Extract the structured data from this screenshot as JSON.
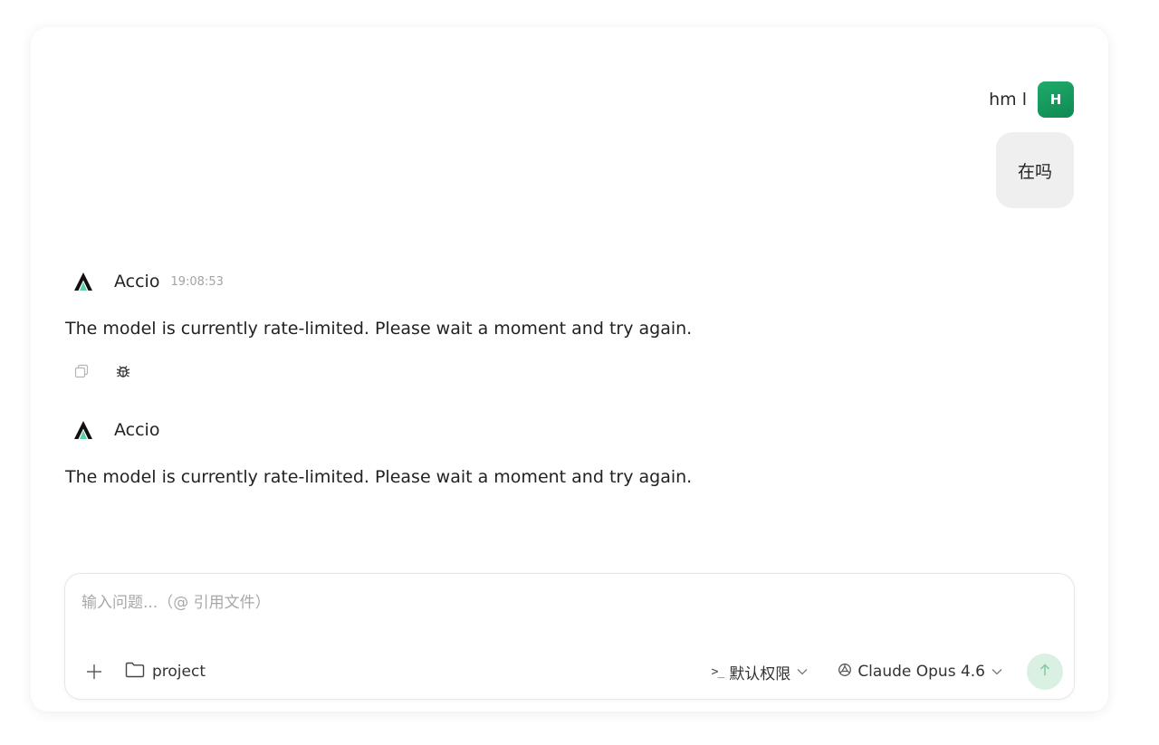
{
  "user": {
    "name": "hm l",
    "avatar_initial": "H",
    "message": "在吗"
  },
  "messages": [
    {
      "sender": "Accio",
      "time": "19:08:53",
      "text": "The model is currently rate-limited. Please wait a moment and try again."
    },
    {
      "sender": "Accio",
      "text": "The model is currently rate-limited. Please wait a moment and try again."
    }
  ],
  "composer": {
    "placeholder": "输入问题...（@ 引用文件）",
    "project_label": "project",
    "permission_prefix": ">_",
    "permission_label": "默认权限",
    "model_label": "Claude Opus 4.6"
  },
  "icons": {
    "copy": "copy-icon",
    "debug": "bug-icon",
    "add": "plus-icon",
    "folder": "folder-icon",
    "chevron": "chevron-down-icon",
    "model": "model-icon",
    "send": "arrow-up-icon"
  },
  "colors": {
    "avatar": "#14995e",
    "send_button_bg": "#d9f0e2",
    "send_arrow": "#7fcaa0",
    "bubble": "#efefef"
  }
}
